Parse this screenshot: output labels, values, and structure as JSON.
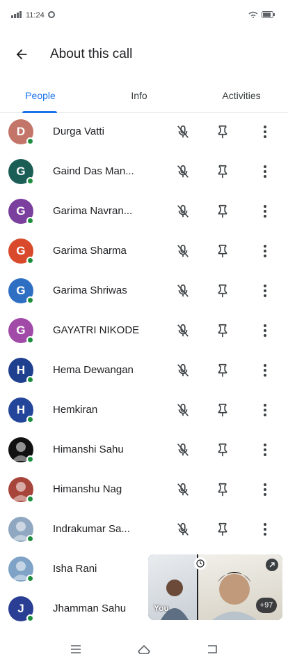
{
  "status_bar": {
    "time": "11:24"
  },
  "header": {
    "title": "About this call"
  },
  "tabs": [
    {
      "label": "People",
      "active": true
    },
    {
      "label": "Info",
      "active": false
    },
    {
      "label": "Activities",
      "active": false
    }
  ],
  "participants": [
    {
      "name": "Durga Vatti",
      "initial": "D",
      "color": "#c4756a",
      "icon": "avatar-initial-icon"
    },
    {
      "name": "Gaind Das Man...",
      "initial": "G",
      "color": "#1b5e56",
      "icon": "avatar-initial-icon"
    },
    {
      "name": "Garima Navran...",
      "initial": "G",
      "color": "#7b3f9e",
      "icon": "avatar-initial-icon"
    },
    {
      "name": "Garima Sharma",
      "initial": "G",
      "color": "#d84a2b",
      "icon": "avatar-initial-icon"
    },
    {
      "name": "Garima Shriwas",
      "initial": "G",
      "color": "#2f6fc3",
      "icon": "avatar-initial-icon"
    },
    {
      "name": "GAYATRI NIKODE",
      "initial": "G",
      "color": "#a14aa8",
      "icon": "avatar-initial-icon"
    },
    {
      "name": "Hema Dewangan",
      "initial": "H",
      "color": "#1f3f8f",
      "icon": "avatar-initial-icon"
    },
    {
      "name": "Hemkiran",
      "initial": "H",
      "color": "#24469a",
      "icon": "avatar-initial-icon"
    },
    {
      "name": "Himanshi Sahu",
      "initial": "",
      "color": "#111111",
      "icon": "avatar-photo-icon"
    },
    {
      "name": "Himanshu Nag",
      "initial": "",
      "color": "#a8453a",
      "icon": "avatar-photo-icon"
    },
    {
      "name": "Indrakumar Sa...",
      "initial": "",
      "color": "#8fa7c0",
      "icon": "avatar-photo-icon"
    },
    {
      "name": "Isha Rani",
      "initial": "",
      "color": "#7ea3c6",
      "icon": "avatar-photo-icon"
    },
    {
      "name": "Jhamman Sahu",
      "initial": "J",
      "color": "#2a3f94",
      "icon": "avatar-initial-icon"
    }
  ],
  "pip": {
    "you_label": "You",
    "count": "+97"
  },
  "colors": {
    "accent": "#1a73e8",
    "presence": "#1e8e3e"
  }
}
